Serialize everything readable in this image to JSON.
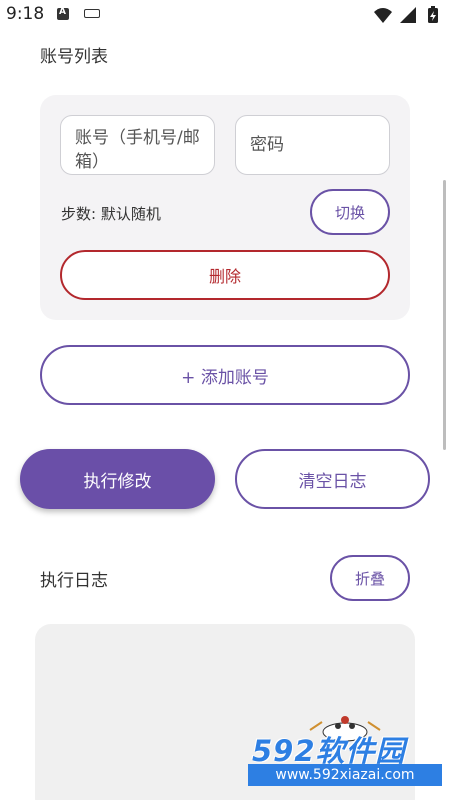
{
  "status_bar": {
    "time": "9:18",
    "icons": [
      "a-box-icon",
      "keyboard-icon",
      "wifi-icon",
      "signal-icon",
      "battery-icon"
    ]
  },
  "account_section": {
    "title": "账号列表",
    "account_field": {
      "placeholder": "账号（手机号/邮箱）"
    },
    "password_field": {
      "placeholder": "密码"
    },
    "steps_label": "步数: 默认随机",
    "switch_label": "切换",
    "delete_label": "删除"
  },
  "add_account_label": "+ 添加账号",
  "actions": {
    "execute_label": "执行修改",
    "clear_log_label": "清空日志"
  },
  "log_section": {
    "title": "执行日志",
    "fold_label": "折叠"
  },
  "watermark": {
    "brand": "592软件园",
    "url": "www.592xiazai.com"
  },
  "colors": {
    "accent": "#6a4fa8",
    "danger": "#b3282d",
    "card_bg": "#f4f3f5",
    "log_bg": "#f0f0f0",
    "watermark_blue": "#2d7fe3"
  }
}
